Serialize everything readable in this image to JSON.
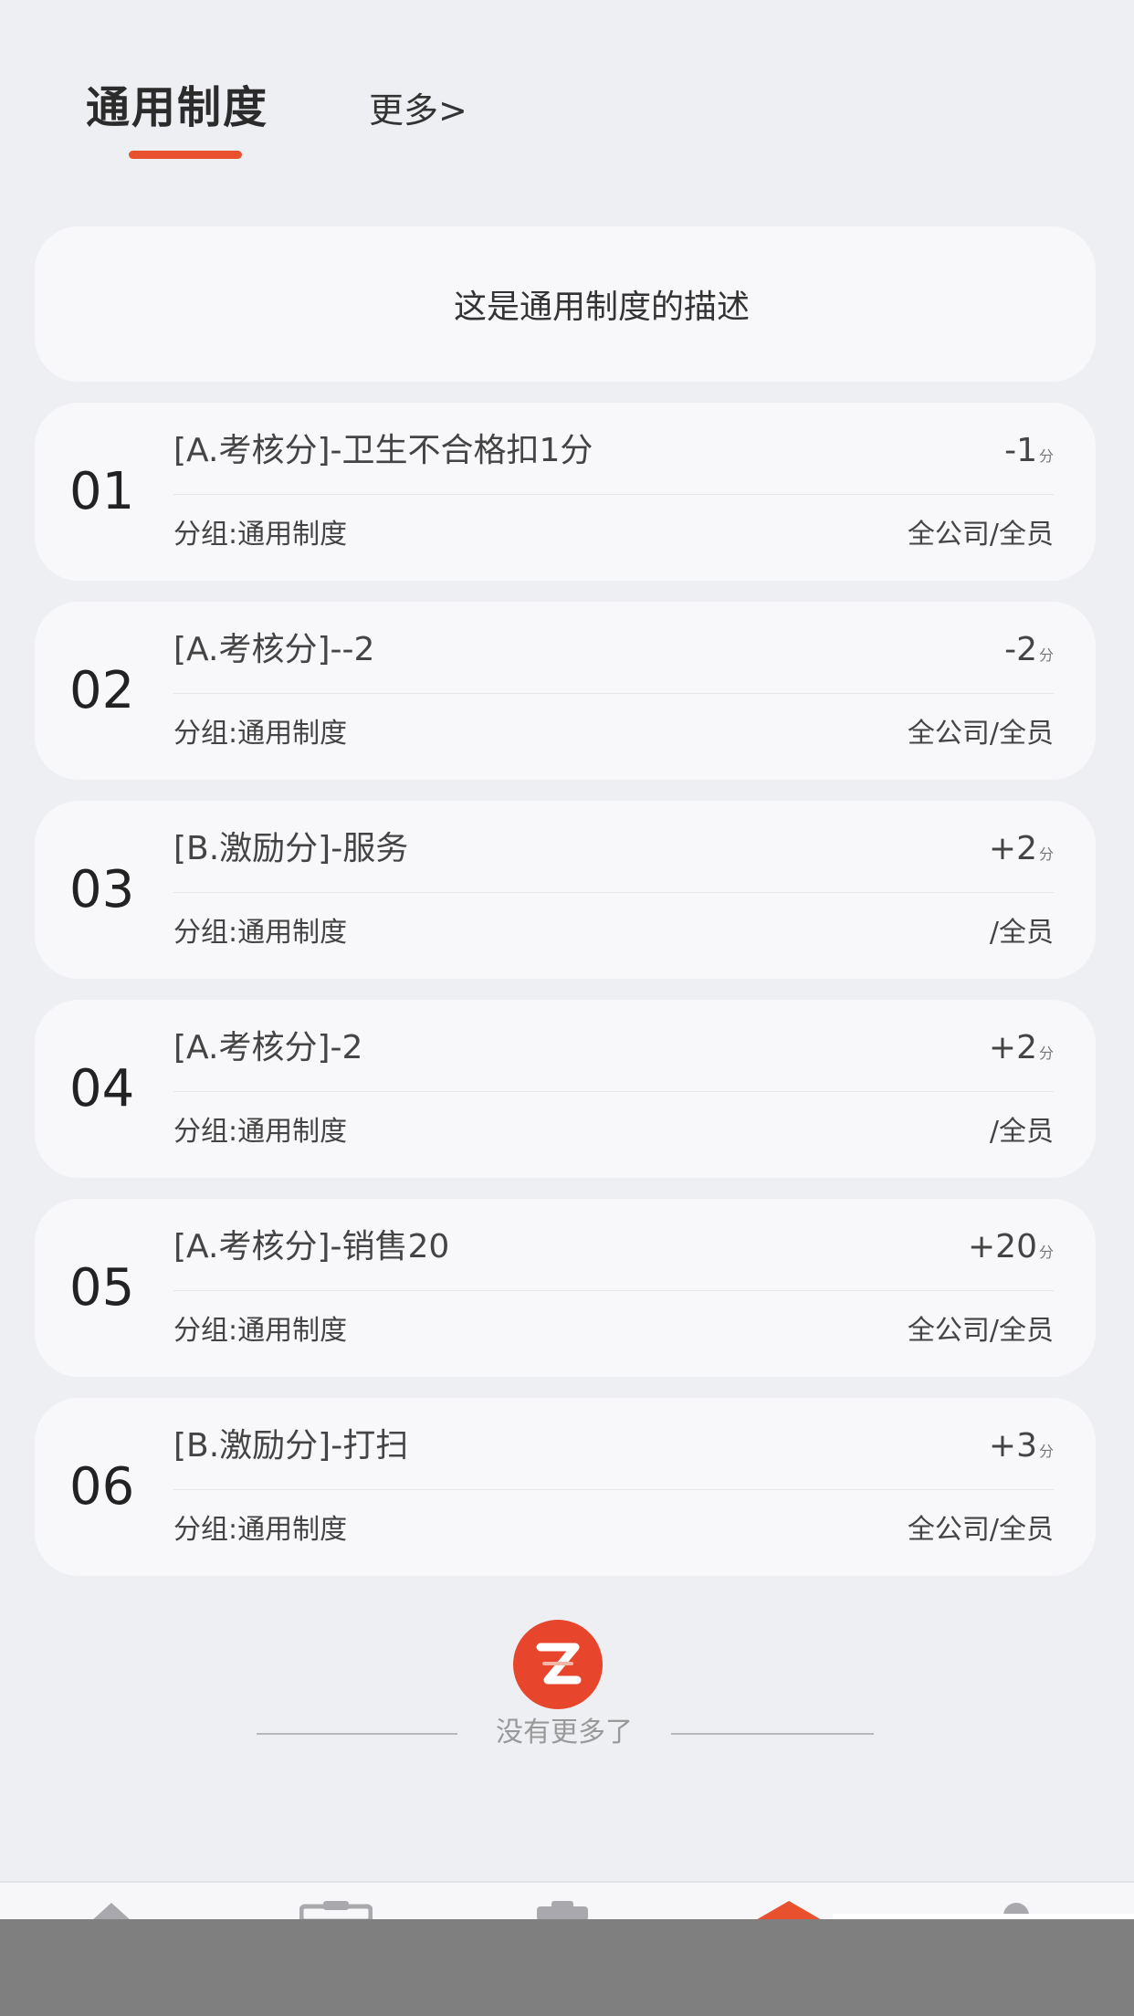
{
  "tabs": {
    "active_label": "通用制度",
    "more_label": "更多>"
  },
  "description": "这是通用制度的描述",
  "rules": [
    {
      "index": "01",
      "title": "[A.考核分]-卫生不合格扣1分",
      "score": "-1",
      "unit": "分",
      "group": "分组:通用制度",
      "scope": "全公司/全员"
    },
    {
      "index": "02",
      "title": "[A.考核分]--2",
      "score": "-2",
      "unit": "分",
      "group": "分组:通用制度",
      "scope": "全公司/全员"
    },
    {
      "index": "03",
      "title": "[B.激励分]-服务",
      "score": "+2",
      "unit": "分",
      "group": "分组:通用制度",
      "scope": "/全员"
    },
    {
      "index": "04",
      "title": "[A.考核分]-2",
      "score": "+2",
      "unit": "分",
      "group": "分组:通用制度",
      "scope": "/全员"
    },
    {
      "index": "05",
      "title": "[A.考核分]-销售20",
      "score": "+20",
      "unit": "分",
      "group": "分组:通用制度",
      "scope": "全公司/全员"
    },
    {
      "index": "06",
      "title": "[B.激励分]-打扫",
      "score": "+3",
      "unit": "分",
      "group": "分组:通用制度",
      "scope": "全公司/全员"
    }
  ],
  "footer": {
    "end_text": "没有更多了",
    "logo_icon": "z-logo-icon"
  },
  "nav": {
    "icons": [
      "home-icon",
      "briefcase-icon",
      "clipboard-icon",
      "house-active-icon",
      "user-icon"
    ],
    "accent_color": "#e8502e"
  },
  "colors": {
    "accent": "#e8502e",
    "background": "#eeeff3",
    "card": "#f8f8fa"
  }
}
